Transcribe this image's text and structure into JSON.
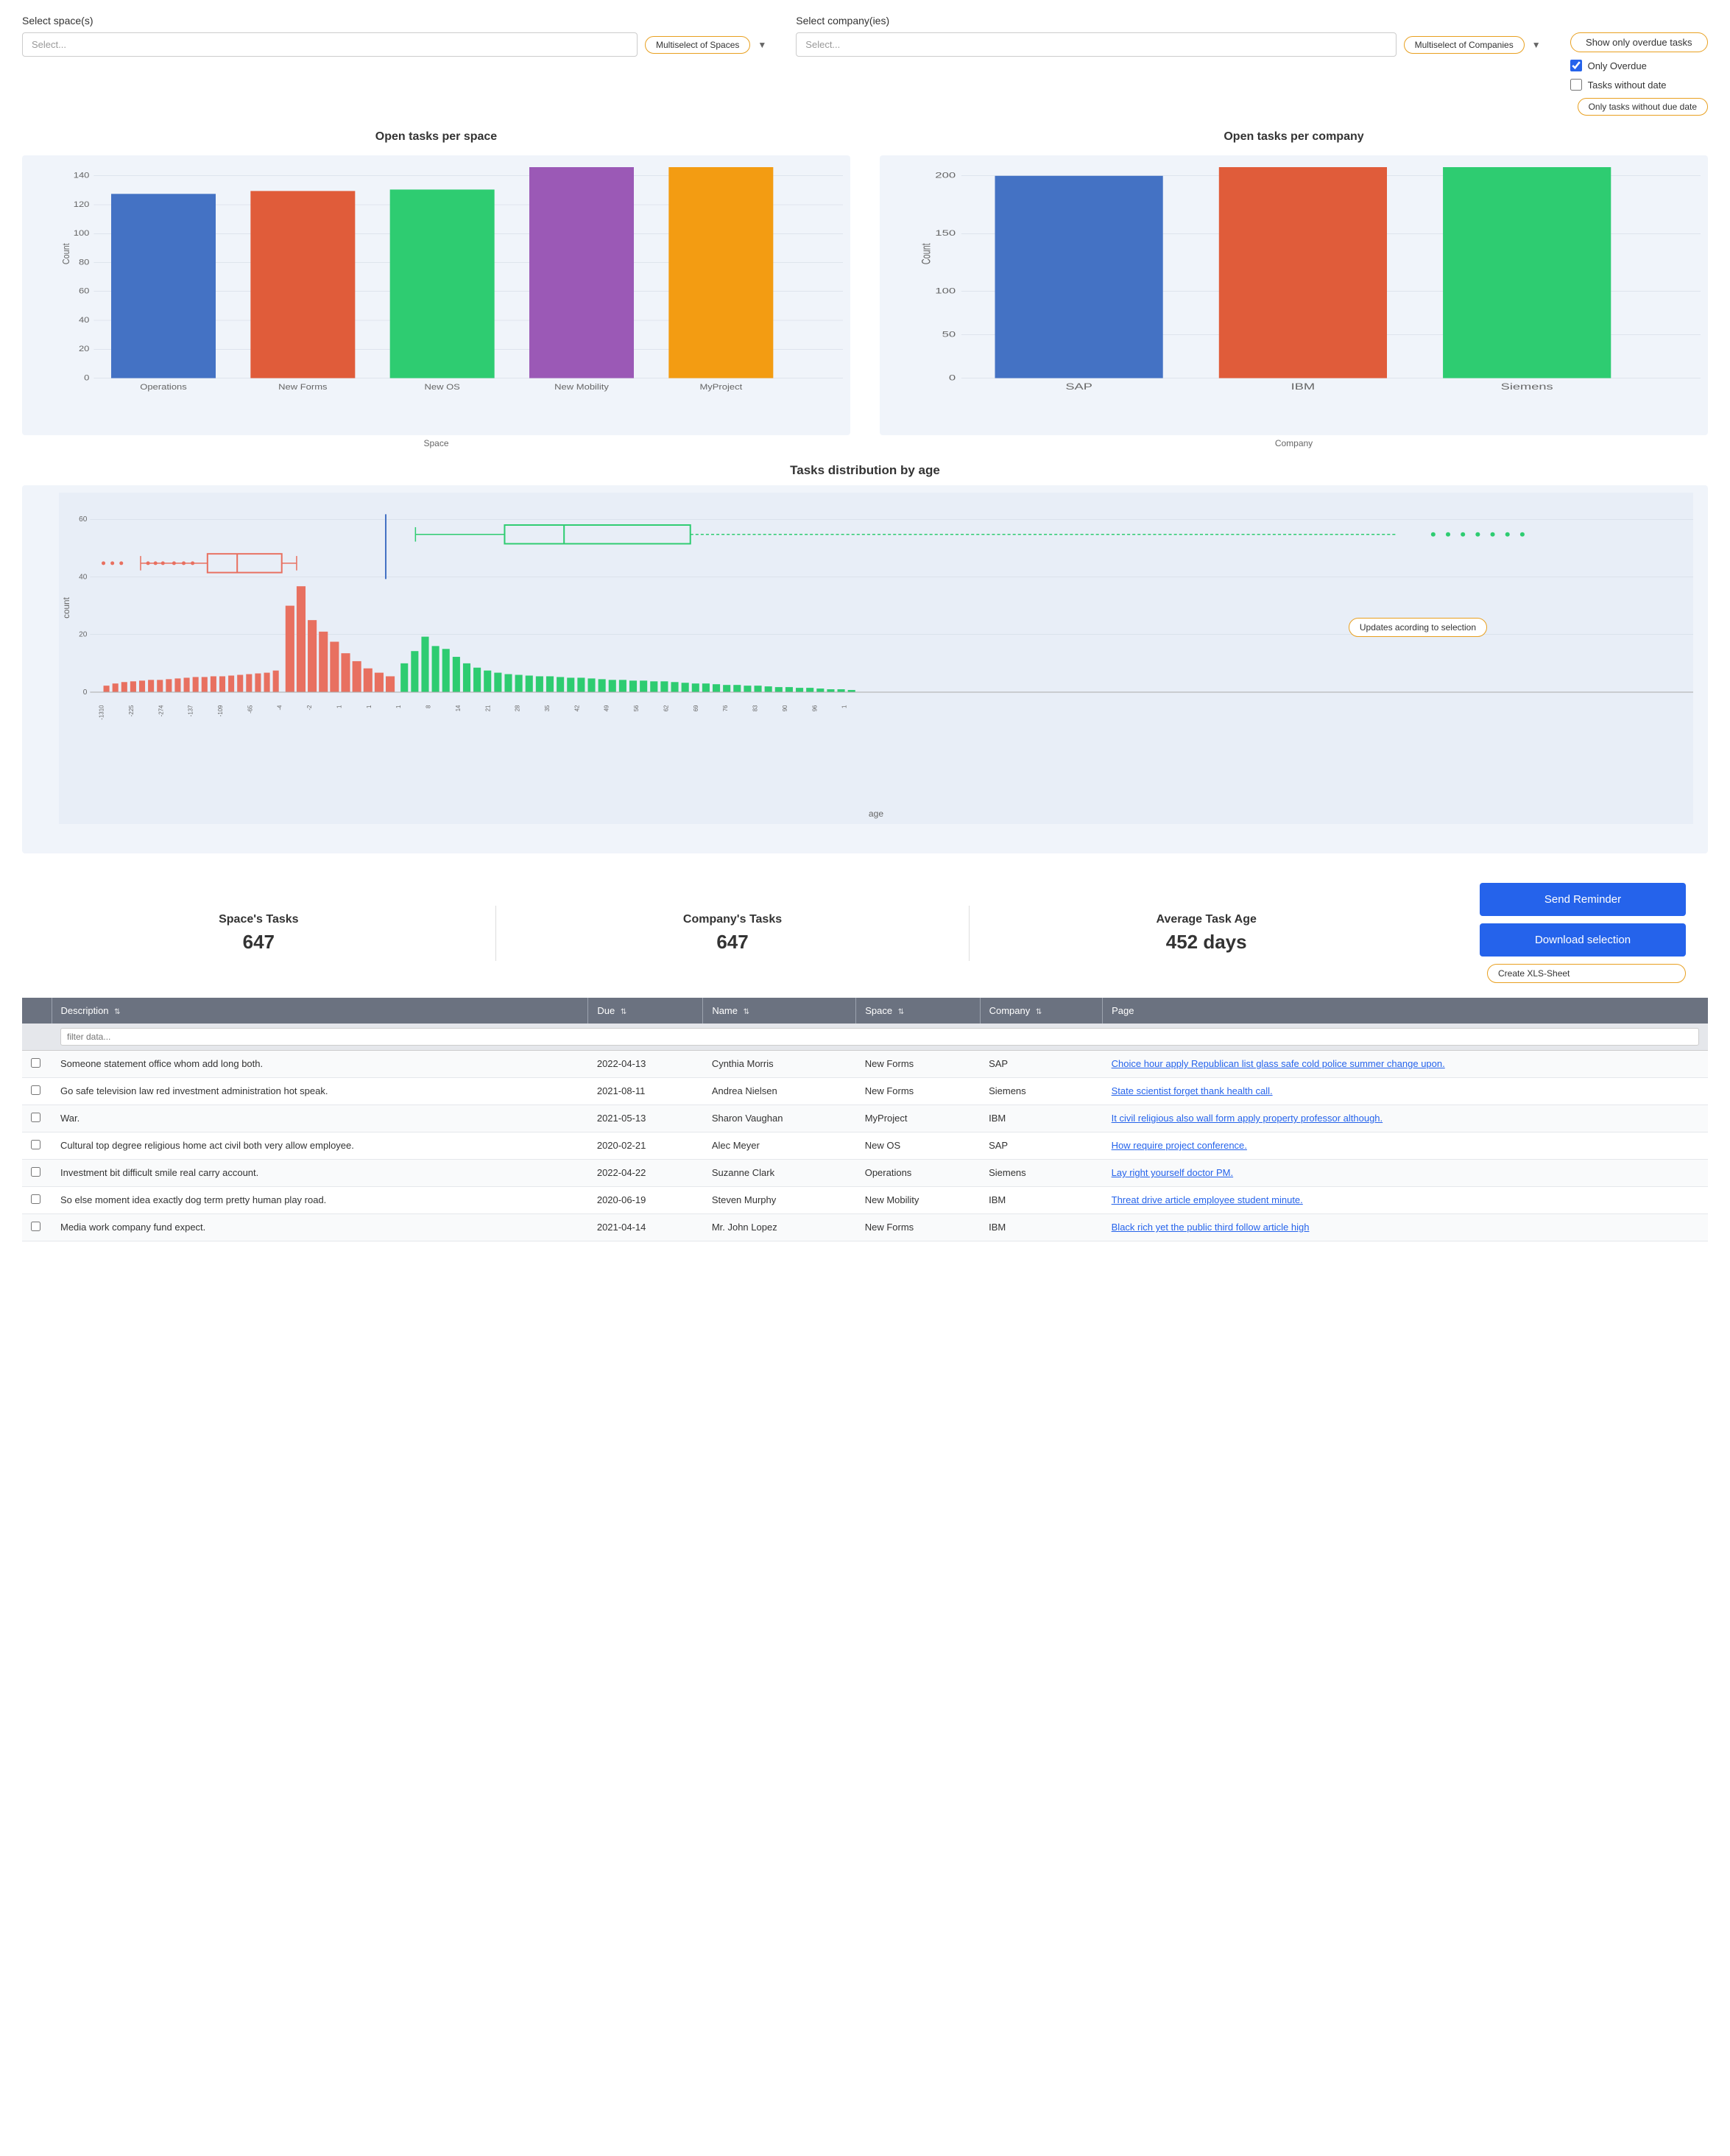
{
  "filters": {
    "spaces_label": "Select space(s)",
    "spaces_placeholder": "Select...",
    "spaces_multiselect": "Multiselect of Spaces",
    "companies_label": "Select company(ies)",
    "companies_placeholder": "Select...",
    "companies_multiselect": "Multiselect of Companies",
    "show_overdue_button": "Show only overdue tasks",
    "only_overdue_label": "Only Overdue",
    "tasks_without_date_label": "Tasks without date",
    "only_tasks_no_due_label": "Only tasks without due date"
  },
  "charts": {
    "spaces_title": "Open tasks per space",
    "spaces_xlabel": "Space",
    "spaces_ylabel": "Count",
    "spaces_bars": [
      {
        "label": "Operations",
        "value": 118,
        "color": "#4472C4"
      },
      {
        "label": "New Forms",
        "value": 120,
        "color": "#E05C3A"
      },
      {
        "label": "New OS",
        "value": 121,
        "color": "#2ECC71"
      },
      {
        "label": "New Mobility",
        "value": 140,
        "color": "#9B59B6"
      },
      {
        "label": "MyProject",
        "value": 148,
        "color": "#F39C12"
      }
    ],
    "companies_title": "Open tasks per company",
    "companies_xlabel": "Company",
    "companies_ylabel": "Count",
    "companies_bars": [
      {
        "label": "SAP",
        "value": 200,
        "color": "#4472C4"
      },
      {
        "label": "IBM",
        "value": 220,
        "color": "#E05C3A"
      },
      {
        "label": "Siemens",
        "value": 215,
        "color": "#2ECC71"
      }
    ],
    "distribution_title": "Tasks distribution by age",
    "distribution_xlabel": "age",
    "distribution_ylabel": "count",
    "updates_annotation": "Updates acording to selection"
  },
  "stats": {
    "spaces_tasks_label": "Space's Tasks",
    "spaces_tasks_value": "647",
    "companies_tasks_label": "Company's Tasks",
    "companies_tasks_value": "647",
    "avg_age_label": "Average Task Age",
    "avg_age_value": "452 days"
  },
  "actions": {
    "send_reminder": "Send Reminder",
    "download_selection": "Download selection",
    "create_xls": "Create XLS-Sheet"
  },
  "table": {
    "columns": [
      "",
      "Description",
      "Due",
      "Name",
      "Space",
      "Company",
      "Page"
    ],
    "filter_placeholder": "filter data...",
    "rows": [
      {
        "checked": false,
        "description": "Someone statement office whom add long both.",
        "due": "2022-04-13",
        "name": "Cynthia Morris",
        "space": "New Forms",
        "company": "SAP",
        "page": "Choice hour apply Republican list glass safe cold police summer change upon."
      },
      {
        "checked": false,
        "description": "Go safe television law red investment administration hot speak.",
        "due": "2021-08-11",
        "name": "Andrea Nielsen",
        "space": "New Forms",
        "company": "Siemens",
        "page": "State scientist forget thank health call."
      },
      {
        "checked": false,
        "description": "War.",
        "due": "2021-05-13",
        "name": "Sharon Vaughan",
        "space": "MyProject",
        "company": "IBM",
        "page": "It civil religious also wall form apply property professor although."
      },
      {
        "checked": false,
        "description": "Cultural top degree religious home act civil both very allow employee.",
        "due": "2020-02-21",
        "name": "Alec Meyer",
        "space": "New OS",
        "company": "SAP",
        "page": "How require project conference."
      },
      {
        "checked": false,
        "description": "Investment bit difficult smile real carry account.",
        "due": "2022-04-22",
        "name": "Suzanne Clark",
        "space": "Operations",
        "company": "Siemens",
        "page": "Lay right yourself doctor PM."
      },
      {
        "checked": false,
        "description": "So else moment idea exactly dog term pretty human play road.",
        "due": "2020-06-19",
        "name": "Steven Murphy",
        "space": "New Mobility",
        "company": "IBM",
        "page": "Threat drive article employee student minute."
      },
      {
        "checked": false,
        "description": "Media work company fund expect.",
        "due": "2021-04-14",
        "name": "Mr. John Lopez",
        "space": "New Forms",
        "company": "IBM",
        "page": "Black rich yet the public third follow article high"
      }
    ]
  }
}
